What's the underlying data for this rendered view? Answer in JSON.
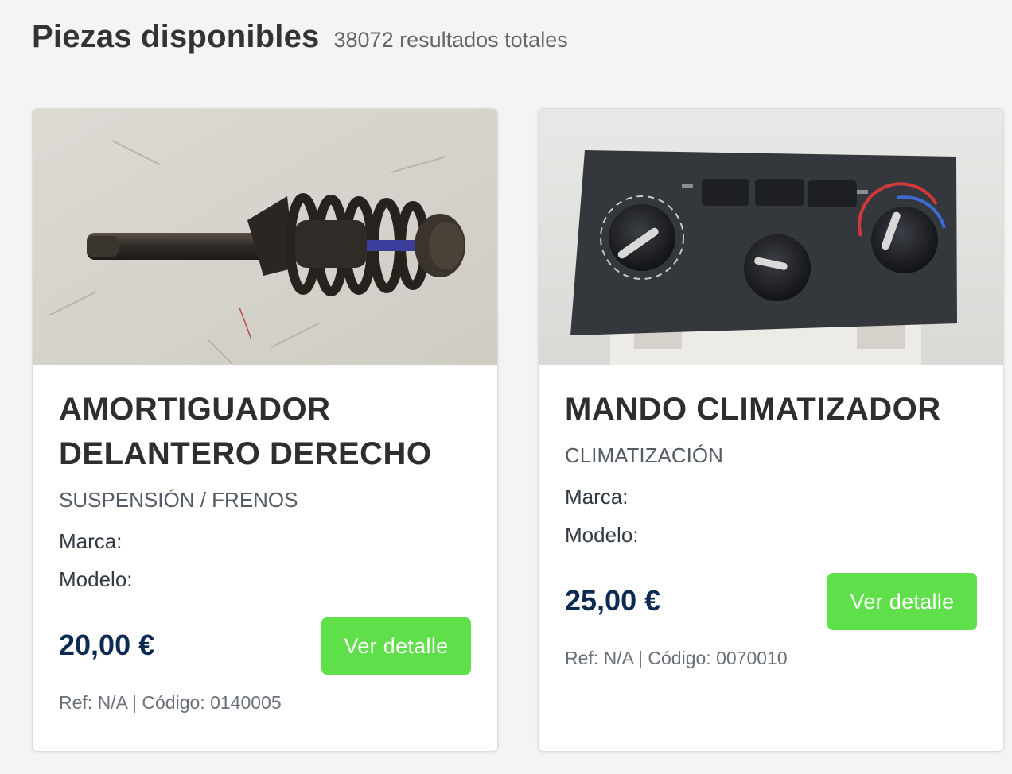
{
  "header": {
    "title": "Piezas disponibles",
    "results": "38072 resultados totales"
  },
  "cards": [
    {
      "title_line1": "AMORTIGUADOR",
      "title_line2": "DELANTERO DERECHO",
      "category": "SUSPENSIÓN / FRENOS",
      "brand_label": "Marca:",
      "model_label": "Modelo:",
      "price": "20,00 €",
      "button": "Ver detalle",
      "ref": "Ref: N/A | Código: 0140005"
    },
    {
      "title_line1": "MANDO CLIMATIZADOR",
      "category": "CLIMATIZACIÓN",
      "brand_label": "Marca:",
      "model_label": "Modelo:",
      "price": "25,00 €",
      "button": "Ver detalle",
      "ref": "Ref: N/A | Código: 0070010"
    }
  ],
  "colors": {
    "button": "#5fe04a",
    "price": "#0d2a52",
    "background": "#f4f4f4"
  }
}
